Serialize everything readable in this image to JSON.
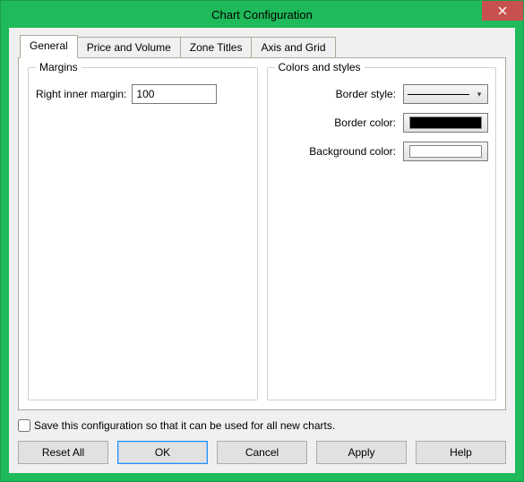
{
  "window": {
    "title": "Chart Configuration"
  },
  "tabs": {
    "general": "General",
    "price_volume": "Price and Volume",
    "zone_titles": "Zone Titles",
    "axis_grid": "Axis and Grid"
  },
  "margins": {
    "legend": "Margins",
    "right_inner_label": "Right inner margin:",
    "right_inner_value": "100"
  },
  "colors_styles": {
    "legend": "Colors and styles",
    "border_style_label": "Border style:",
    "border_color_label": "Border color:",
    "background_color_label": "Background color:",
    "border_color": "#000000",
    "background_color": "#ffffff"
  },
  "save_check_label": "Save this configuration so that it can be used for all new charts.",
  "buttons": {
    "reset_all": "Reset All",
    "ok": "OK",
    "cancel": "Cancel",
    "apply": "Apply",
    "help": "Help"
  }
}
